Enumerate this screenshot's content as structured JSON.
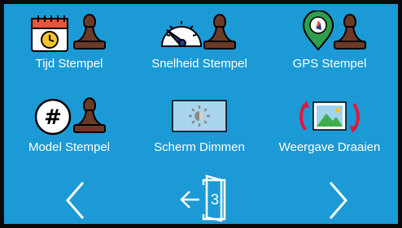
{
  "menu": {
    "items": [
      {
        "label": "Tijd Stempel",
        "icon": "calendar-clock-stamp-icon"
      },
      {
        "label": "Snelheid Stempel",
        "icon": "speedometer-stamp-icon"
      },
      {
        "label": "GPS Stempel",
        "icon": "gps-pin-stamp-icon"
      },
      {
        "label": "Model Stempel",
        "icon": "hash-stamp-icon"
      },
      {
        "label": "Scherm Dimmen",
        "icon": "dim-screen-icon"
      },
      {
        "label": "Weergave Draaien",
        "icon": "rotate-display-icon"
      }
    ]
  },
  "nav": {
    "prev_icon": "chevron-left-icon",
    "next_icon": "chevron-right-icon",
    "exit_icon": "exit-door-icon",
    "page_number": "3"
  },
  "colors": {
    "background": "#1c9ad6",
    "stamp": "#6b3a26",
    "text": "#ffffff",
    "rotate_arrows": "#e3173c",
    "gps_pin": "#2e9e4e"
  }
}
